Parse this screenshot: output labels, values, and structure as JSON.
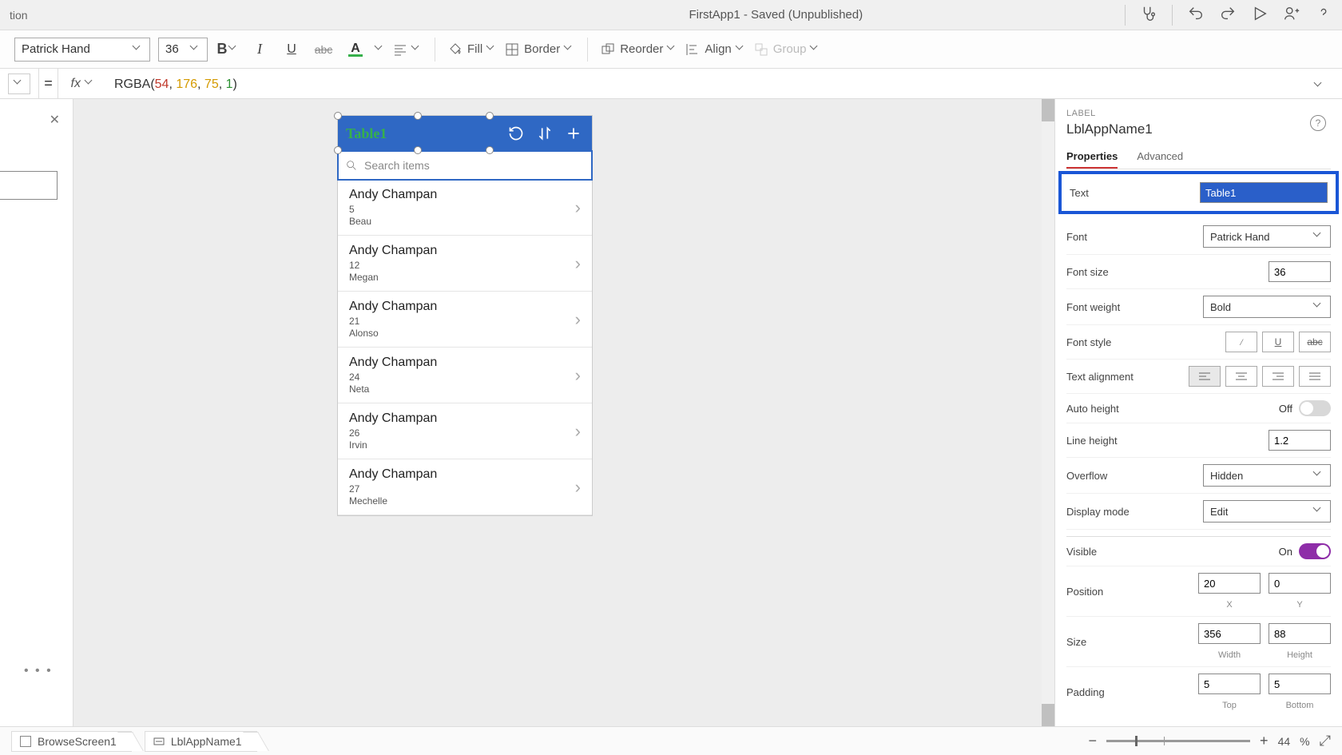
{
  "header": {
    "title_left": "tion",
    "title_center": "FirstApp1 - Saved (Unpublished)"
  },
  "ribbon": {
    "font": "Patrick Hand",
    "size": "36",
    "bold": "B",
    "italic": "I",
    "underline": "U",
    "strike": "abc",
    "font_color_letter": "A",
    "fill": "Fill",
    "border": "Border",
    "reorder": "Reorder",
    "align": "Align",
    "group": "Group"
  },
  "formula": {
    "fn": "RGBA",
    "args": [
      "54",
      "176",
      "75",
      "1"
    ]
  },
  "phone": {
    "title": "Table1",
    "search_placeholder": "Search items",
    "items": [
      {
        "name": "Andy Champan",
        "num": "5",
        "sub": "Beau"
      },
      {
        "name": "Andy Champan",
        "num": "12",
        "sub": "Megan"
      },
      {
        "name": "Andy Champan",
        "num": "21",
        "sub": "Alonso"
      },
      {
        "name": "Andy Champan",
        "num": "24",
        "sub": "Neta"
      },
      {
        "name": "Andy Champan",
        "num": "26",
        "sub": "Irvin"
      },
      {
        "name": "Andy Champan",
        "num": "27",
        "sub": "Mechelle"
      }
    ]
  },
  "right": {
    "category": "LABEL",
    "name": "LblAppName1",
    "tab_properties": "Properties",
    "tab_advanced": "Advanced",
    "text_label": "Text",
    "text_value": "Table1",
    "font_label": "Font",
    "font_value": "Patrick Hand",
    "fontsize_label": "Font size",
    "fontsize_value": "36",
    "fontweight_label": "Font weight",
    "fontweight_value": "Bold",
    "fontstyle_label": "Font style",
    "textalign_label": "Text alignment",
    "autoheight_label": "Auto height",
    "autoheight_state": "Off",
    "lineheight_label": "Line height",
    "lineheight_value": "1.2",
    "overflow_label": "Overflow",
    "overflow_value": "Hidden",
    "displaymode_label": "Display mode",
    "displaymode_value": "Edit",
    "visible_label": "Visible",
    "visible_state": "On",
    "position_label": "Position",
    "pos_x": "20",
    "pos_y": "0",
    "pos_xl": "X",
    "pos_yl": "Y",
    "size_label": "Size",
    "size_w": "356",
    "size_h": "88",
    "size_wl": "Width",
    "size_hl": "Height",
    "padding_label": "Padding",
    "pad_t": "5",
    "pad_b": "5",
    "pad_tl": "Top",
    "pad_bl": "Bottom"
  },
  "status": {
    "crumb1": "BrowseScreen1",
    "crumb2": "LblAppName1",
    "zoom_value": "44",
    "zoom_pct": "%"
  }
}
